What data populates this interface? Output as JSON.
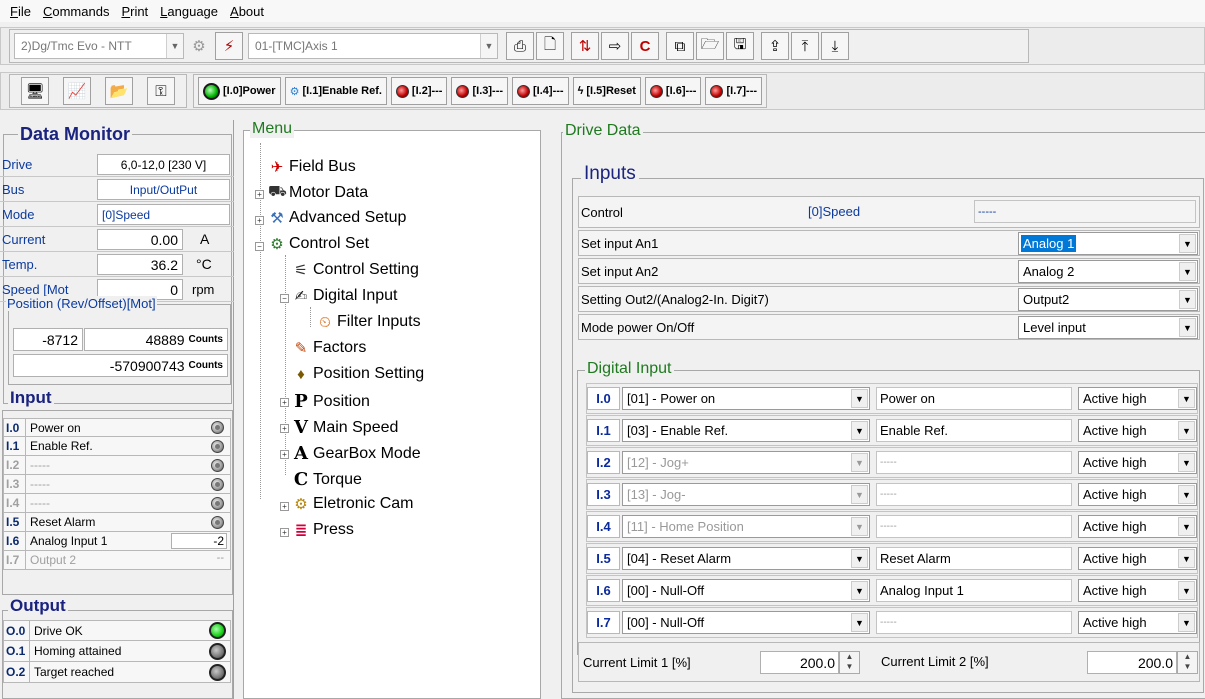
{
  "menubar": [
    "File",
    "Commands",
    "Print",
    "Language",
    "About"
  ],
  "toolbar": {
    "device_combo": "2)Dg/Tmc Evo - NTT",
    "axis_combo": "01-[TMC]Axis 1",
    "io_buttons": [
      {
        "label": "[I.0]Power",
        "icon": "power-led-icon"
      },
      {
        "label": "[I.1]Enable Ref.",
        "icon": "enable-ref-icon"
      },
      {
        "label": "[I.2]---",
        "icon": "red-led-icon"
      },
      {
        "label": "[I.3]---",
        "icon": "red-led-icon"
      },
      {
        "label": "[I.4]---",
        "icon": "red-led-icon"
      },
      {
        "label": "[I.5]Reset",
        "icon": "reset-lightning-icon"
      },
      {
        "label": "[I.6]---",
        "icon": "red-led-icon"
      },
      {
        "label": "[I.7]---",
        "icon": "red-led-icon"
      }
    ]
  },
  "data_monitor": {
    "title": "Data Monitor",
    "rows": [
      {
        "label": "Drive",
        "value": "6,0-12,0 [230 V]",
        "unit": ""
      },
      {
        "label": "Bus",
        "value": "Input/OutPut",
        "unit": ""
      },
      {
        "label": "Mode",
        "value": "[0]Speed",
        "unit": ""
      },
      {
        "label": "Current",
        "value": "0.00",
        "unit": "A"
      },
      {
        "label": "Temp.",
        "value": "36.2",
        "unit": "°C"
      },
      {
        "label": "Speed [Mot",
        "value": "0",
        "unit": "rpm"
      }
    ],
    "position_title": "Position (Rev/Offset)[Mot]",
    "position_rev": "-8712",
    "position_offset": "48889",
    "position_total": "-570900743",
    "counts_label": "Counts"
  },
  "input_section": {
    "title": "Input",
    "rows": [
      {
        "code": "I.0",
        "label": "Power on",
        "disabled": false
      },
      {
        "code": "I.1",
        "label": "Enable Ref.",
        "disabled": false
      },
      {
        "code": "I.2",
        "label": "-----",
        "disabled": true
      },
      {
        "code": "I.3",
        "label": "-----",
        "disabled": true
      },
      {
        "code": "I.4",
        "label": "-----",
        "disabled": true
      },
      {
        "code": "I.5",
        "label": "Reset Alarm",
        "disabled": false
      },
      {
        "code": "I.6",
        "label": "Analog Input 1",
        "disabled": false,
        "value": "-2"
      },
      {
        "code": "I.7",
        "label": "Output 2",
        "disabled": true,
        "value": "--"
      }
    ]
  },
  "output_section": {
    "title": "Output",
    "rows": [
      {
        "code": "O.0",
        "label": "Drive OK",
        "state": "green"
      },
      {
        "code": "O.1",
        "label": "Homing attained",
        "state": "gray"
      },
      {
        "code": "O.2",
        "label": "Target reached",
        "state": "gray"
      }
    ]
  },
  "menu": {
    "title": "Menu",
    "items": [
      {
        "label": "Field Bus",
        "icon": "field-bus-icon"
      },
      {
        "label": "Motor Data",
        "icon": "motor-data-icon"
      },
      {
        "label": "Advanced Setup",
        "icon": "advanced-setup-icon"
      },
      {
        "label": "Control Set",
        "icon": "control-set-icon"
      },
      {
        "label": "Control Setting",
        "icon": "control-setting-icon"
      },
      {
        "label": "Digital Input",
        "icon": "digital-input-icon"
      },
      {
        "label": "Filter Inputs",
        "icon": "filter-inputs-icon"
      },
      {
        "label": "Factors",
        "icon": "factors-icon"
      },
      {
        "label": "Position Setting",
        "icon": "position-setting-icon"
      },
      {
        "label": "Position",
        "icon": "position-icon"
      },
      {
        "label": "Main Speed",
        "icon": "main-speed-icon"
      },
      {
        "label": "GearBox Mode",
        "icon": "gearbox-icon"
      },
      {
        "label": "Torque",
        "icon": "torque-icon"
      },
      {
        "label": "Eletronic Cam",
        "icon": "cam-icon"
      },
      {
        "label": "Press",
        "icon": "press-icon"
      }
    ]
  },
  "drive_data": {
    "title": "Drive Data",
    "inputs_title": "Inputs",
    "control_label": "Control",
    "control_value": "[0]Speed",
    "control_status": "-----",
    "settings": [
      {
        "label": "Set input An1",
        "value": "Analog 1"
      },
      {
        "label": "Set input An2",
        "value": "Analog 2"
      },
      {
        "label": "Setting Out2/(Analog2-In. Digit7)",
        "value": "Output2"
      },
      {
        "label": "Mode power On/Off",
        "value": "Level input"
      }
    ],
    "digital_input_title": "Digital Input",
    "digital_inputs": [
      {
        "code": "I.0",
        "function": "[01] - Power on",
        "name": "Power on",
        "level": "Active high",
        "gray": false
      },
      {
        "code": "I.1",
        "function": "[03] - Enable Ref.",
        "name": "Enable Ref.",
        "level": "Active high",
        "gray": false
      },
      {
        "code": "I.2",
        "function": "[12] - Jog+",
        "name": "-----",
        "level": "Active high",
        "gray": true
      },
      {
        "code": "I.3",
        "function": "[13] - Jog-",
        "name": "-----",
        "level": "Active high",
        "gray": true
      },
      {
        "code": "I.4",
        "function": "[11] - Home Position",
        "name": "-----",
        "level": "Active high",
        "gray": true
      },
      {
        "code": "I.5",
        "function": "[04] - Reset Alarm",
        "name": "Reset Alarm",
        "level": "Active high",
        "gray": false
      },
      {
        "code": "I.6",
        "function": "[00] - Null-Off",
        "name": "Analog Input 1",
        "level": "Active high",
        "gray": false
      },
      {
        "code": "I.7",
        "function": "[00] - Null-Off",
        "name": "-----",
        "level": "Active high",
        "gray": false
      }
    ],
    "current_limit_1_label": "Current Limit 1 [%]",
    "current_limit_1": "200.0",
    "current_limit_2_label": "Current Limit 2 [%]",
    "current_limit_2": "200.0"
  }
}
